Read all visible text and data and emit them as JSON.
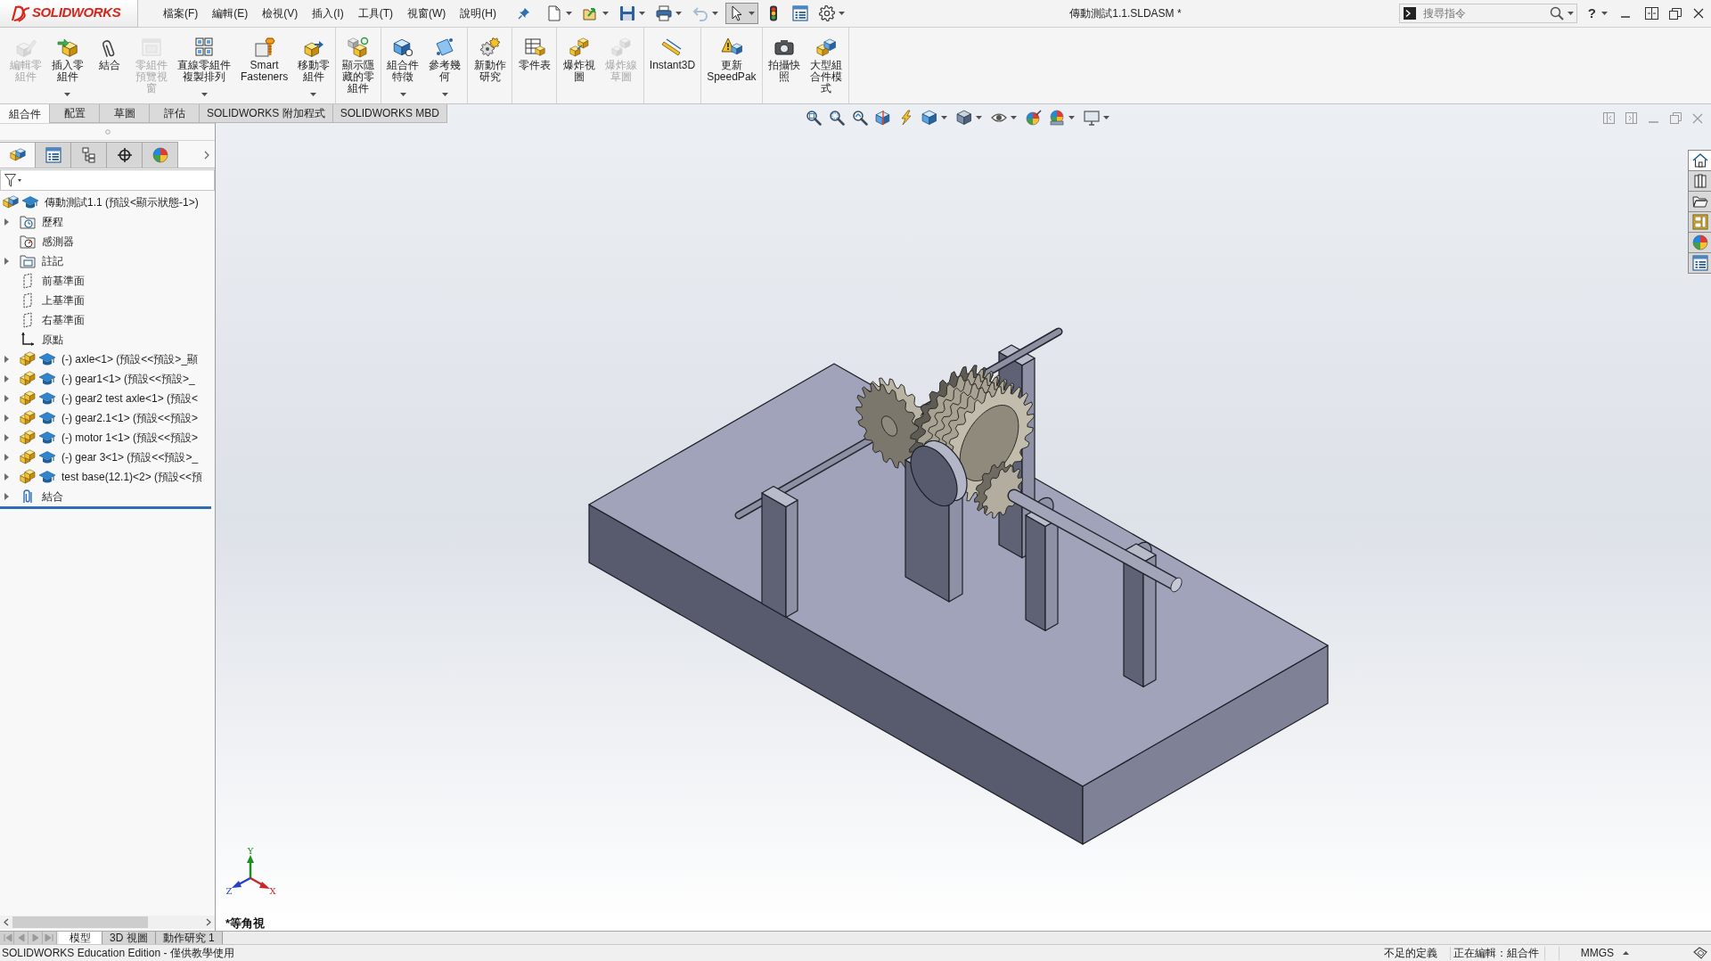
{
  "title_bar": {
    "logo": "SOLIDWORKS",
    "menu": [
      "檔案(F)",
      "編輯(E)",
      "檢視(V)",
      "插入(I)",
      "工具(T)",
      "視窗(W)",
      "說明(H)"
    ],
    "document_title": "傳動測試1.1.SLDASM *",
    "search": {
      "placeholder": "搜尋指令"
    },
    "help": "?"
  },
  "quick_access": [
    {
      "kind": "new",
      "dropdown": true,
      "disabled": false,
      "pressed": false
    },
    {
      "kind": "open",
      "dropdown": true,
      "disabled": false,
      "pressed": false
    },
    {
      "kind": "save",
      "dropdown": true,
      "disabled": false,
      "pressed": false
    },
    {
      "kind": "print",
      "dropdown": true,
      "disabled": false,
      "pressed": false
    },
    {
      "kind": "undo",
      "dropdown": true,
      "disabled": true,
      "pressed": false
    },
    {
      "kind": "select",
      "dropdown": true,
      "disabled": false,
      "pressed": true
    },
    {
      "kind": "rebuild",
      "dropdown": false,
      "disabled": false,
      "pressed": false
    },
    {
      "kind": "file-properties",
      "dropdown": false,
      "disabled": false,
      "pressed": false
    },
    {
      "kind": "options",
      "dropdown": true,
      "disabled": false,
      "pressed": false
    }
  ],
  "ribbon": {
    "groups": [
      {
        "buttons": [
          {
            "label": "編輯零組件",
            "disabled": true,
            "dropdown": false
          },
          {
            "label": "插入零組件",
            "disabled": false,
            "dropdown": true
          },
          {
            "label": "結合",
            "disabled": false,
            "dropdown": false
          },
          {
            "label": "零組件預覽視窗",
            "disabled": true,
            "dropdown": false
          },
          {
            "label": "直線零組件複製排列",
            "disabled": false,
            "dropdown": true
          },
          {
            "label": "Smart Fasteners",
            "disabled": false,
            "dropdown": false
          },
          {
            "label": "移動零組件",
            "disabled": false,
            "dropdown": true
          }
        ]
      },
      {
        "buttons": [
          {
            "label": "顯示隱藏的零組件",
            "disabled": false,
            "dropdown": false
          }
        ]
      },
      {
        "buttons": [
          {
            "label": "組合件特徵",
            "disabled": false,
            "dropdown": true
          },
          {
            "label": "參考幾何",
            "disabled": false,
            "dropdown": true
          }
        ]
      },
      {
        "buttons": [
          {
            "label": "新動作研究",
            "disabled": false,
            "dropdown": false
          }
        ]
      },
      {
        "buttons": [
          {
            "label": "零件表",
            "disabled": false,
            "dropdown": false
          }
        ]
      },
      {
        "buttons": [
          {
            "label": "爆炸視圖",
            "disabled": false,
            "dropdown": false
          },
          {
            "label": "爆炸線草圖",
            "disabled": true,
            "dropdown": false
          }
        ]
      },
      {
        "buttons": [
          {
            "label": "Instant3D",
            "disabled": false,
            "dropdown": false
          }
        ]
      },
      {
        "buttons": [
          {
            "label": "更新SpeedPak",
            "disabled": false,
            "dropdown": false
          }
        ]
      },
      {
        "buttons": [
          {
            "label": "拍攝快照",
            "disabled": false,
            "dropdown": false
          },
          {
            "label": "大型組合件模式",
            "disabled": false,
            "dropdown": false
          }
        ]
      }
    ]
  },
  "ribbon_tabs": [
    {
      "label": "組合件",
      "selected": true
    },
    {
      "label": "配置",
      "selected": false
    },
    {
      "label": "草圖",
      "selected": false
    },
    {
      "label": "評估",
      "selected": false
    },
    {
      "label": "SOLIDWORKS 附加程式",
      "selected": false
    },
    {
      "label": "SOLIDWORKS MBD",
      "selected": false
    }
  ],
  "view_toolbar": [
    {
      "kind": "zoom-fit",
      "dropdown": false
    },
    {
      "kind": "zoom-area",
      "dropdown": false
    },
    {
      "kind": "previous-view",
      "dropdown": false
    },
    {
      "kind": "section-view",
      "dropdown": false
    },
    {
      "kind": "dynamic-annotation",
      "dropdown": false
    },
    {
      "kind": "view-orientation",
      "dropdown": true
    },
    {
      "kind": "display-style",
      "dropdown": true
    },
    {
      "kind": "hide-show",
      "dropdown": true
    },
    {
      "kind": "edit-appearance",
      "dropdown": false
    },
    {
      "kind": "apply-scene",
      "dropdown": true
    },
    {
      "kind": "view-settings",
      "dropdown": true
    }
  ],
  "task_pane": [
    {
      "kind": "home",
      "selected": true
    },
    {
      "kind": "library",
      "selected": false
    },
    {
      "kind": "file-explorer",
      "selected": false
    },
    {
      "kind": "view-palette",
      "selected": false
    },
    {
      "kind": "appearances",
      "selected": false
    },
    {
      "kind": "custom-properties",
      "selected": false
    }
  ],
  "feature_manager": {
    "tabs": [
      {
        "kind": "feature-tree",
        "selected": true
      },
      {
        "kind": "property",
        "selected": false
      },
      {
        "kind": "configuration",
        "selected": false
      },
      {
        "kind": "dimxpert",
        "selected": false
      },
      {
        "kind": "display",
        "selected": false
      }
    ],
    "tree": {
      "label": "傳動測試1.1 (預設<顯示狀態-1>)",
      "kind": "assembly",
      "children": [
        {
          "label": "歷程",
          "kind": "history",
          "expandable": true
        },
        {
          "label": "感測器",
          "kind": "sensors",
          "expandable": false
        },
        {
          "label": "註記",
          "kind": "annotations",
          "expandable": true
        },
        {
          "label": "前基準面",
          "kind": "plane",
          "expandable": false
        },
        {
          "label": "上基準面",
          "kind": "plane",
          "expandable": false
        },
        {
          "label": "右基準面",
          "kind": "plane",
          "expandable": false
        },
        {
          "label": "原點",
          "kind": "origin",
          "expandable": false
        },
        {
          "label": "(-) axle<1> (預設<<預設>_顯",
          "kind": "part",
          "expandable": true
        },
        {
          "label": "(-) gear1<1> (預設<<預設>_",
          "kind": "part",
          "expandable": true
        },
        {
          "label": "(-) gear2 test axle<1> (預設<",
          "kind": "part",
          "expandable": true
        },
        {
          "label": "(-) gear2.1<1> (預設<<預設>",
          "kind": "part",
          "expandable": true
        },
        {
          "label": "(-) motor 1<1> (預設<<預設>",
          "kind": "part",
          "expandable": true
        },
        {
          "label": "(-) gear 3<1> (預設<<預設>_",
          "kind": "part",
          "expandable": true
        },
        {
          "label": "test base(12.1)<2> (預設<<預",
          "kind": "part",
          "expandable": true
        },
        {
          "label": "結合",
          "kind": "mates",
          "expandable": true
        }
      ]
    }
  },
  "viewport": {
    "view_name": "*等角視",
    "triad": {
      "y": "Y",
      "x": "X",
      "z": "Z"
    }
  },
  "bottom_tabs": [
    {
      "label": "模型",
      "selected": true
    },
    {
      "label": "3D 視圖",
      "selected": false
    },
    {
      "label": "動作研究 1",
      "selected": false
    }
  ],
  "status_bar": {
    "edition": "SOLIDWORKS Education Edition - 僅供教學使用",
    "definition": "不足的定義",
    "editing": "正在編輯：組合件",
    "units": "MMGS"
  }
}
